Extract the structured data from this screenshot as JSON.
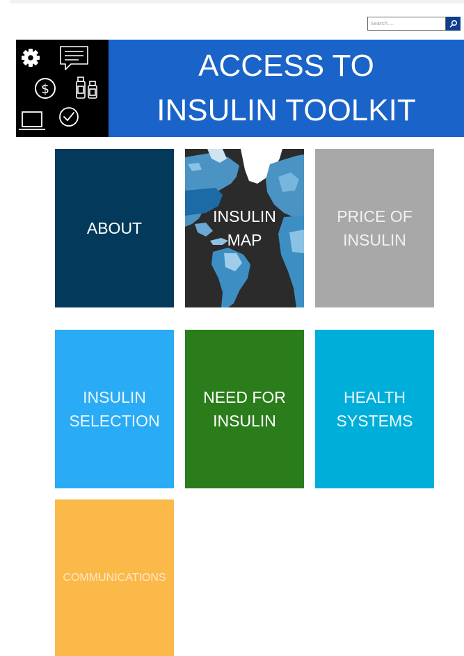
{
  "search": {
    "placeholder": "Search....",
    "button_icon": "search-icon"
  },
  "banner": {
    "title_line1": "ACCESS TO",
    "title_line2": "INSULIN TOOLKIT",
    "icons": [
      "gear-icon",
      "speech-bubble-icon",
      "dollar-coin-icon",
      "insulin-vials-icon",
      "laptop-icon",
      "checkmark-circle-icon"
    ]
  },
  "tiles": {
    "about": {
      "label": "ABOUT",
      "color": "#033a5b"
    },
    "map": {
      "line1": "INSULIN",
      "line2": "MAP",
      "color": "#2b2b2b"
    },
    "price": {
      "line1": "PRICE OF",
      "line2": "INSULIN",
      "color": "#a8a8a8"
    },
    "selection": {
      "line1": "INSULIN",
      "line2": "SELECTION",
      "color": "#29abf5"
    },
    "need": {
      "line1": "NEED FOR",
      "line2": "INSULIN",
      "color": "#2a7d1a"
    },
    "health": {
      "line1": "HEALTH",
      "line2": "SYSTEMS",
      "color": "#00aeda"
    },
    "comms": {
      "label": "COMMUNICATIONS",
      "color": "#fbb94a"
    }
  },
  "colors": {
    "banner_blue": "#1a63c8",
    "search_button": "#0f3f8c"
  }
}
